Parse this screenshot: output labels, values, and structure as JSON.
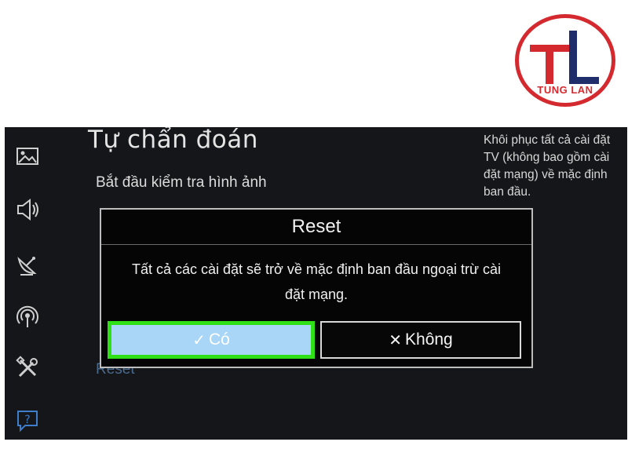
{
  "logo": {
    "letters": "TL",
    "text": "TUNG LAN",
    "colors": {
      "red": "#d42a2f",
      "blue": "#1f2d6b"
    }
  },
  "sidebar": {
    "icons": [
      "picture-icon",
      "sound-icon",
      "broadcast-icon",
      "network-icon",
      "tools-icon",
      "support-icon"
    ]
  },
  "menu": {
    "title": "Tự chẩn đoán",
    "items": [
      {
        "label": "Bắt đầu kiểm tra hình ảnh"
      },
      {
        "label": "Reset"
      }
    ]
  },
  "help_text": "Khôi phục tất cả cài đặt TV (không bao gồm cài đặt mạng) về mặc định ban đầu.",
  "dialog": {
    "title": "Reset",
    "message_line1": "Tất cả các cài đặt sẽ trở về mặc định ban đầu ngoại trừ cài",
    "message_line2": "đặt mạng.",
    "yes_button": {
      "icon": "check-icon",
      "glyph": "✓",
      "label": "Có"
    },
    "no_button": {
      "icon": "close-icon",
      "glyph": "✕",
      "label": "Không"
    }
  },
  "colors": {
    "screen_bg": "#15161a",
    "focus_highlight": "#2fe016",
    "selected_button": "#a9d6f7"
  }
}
